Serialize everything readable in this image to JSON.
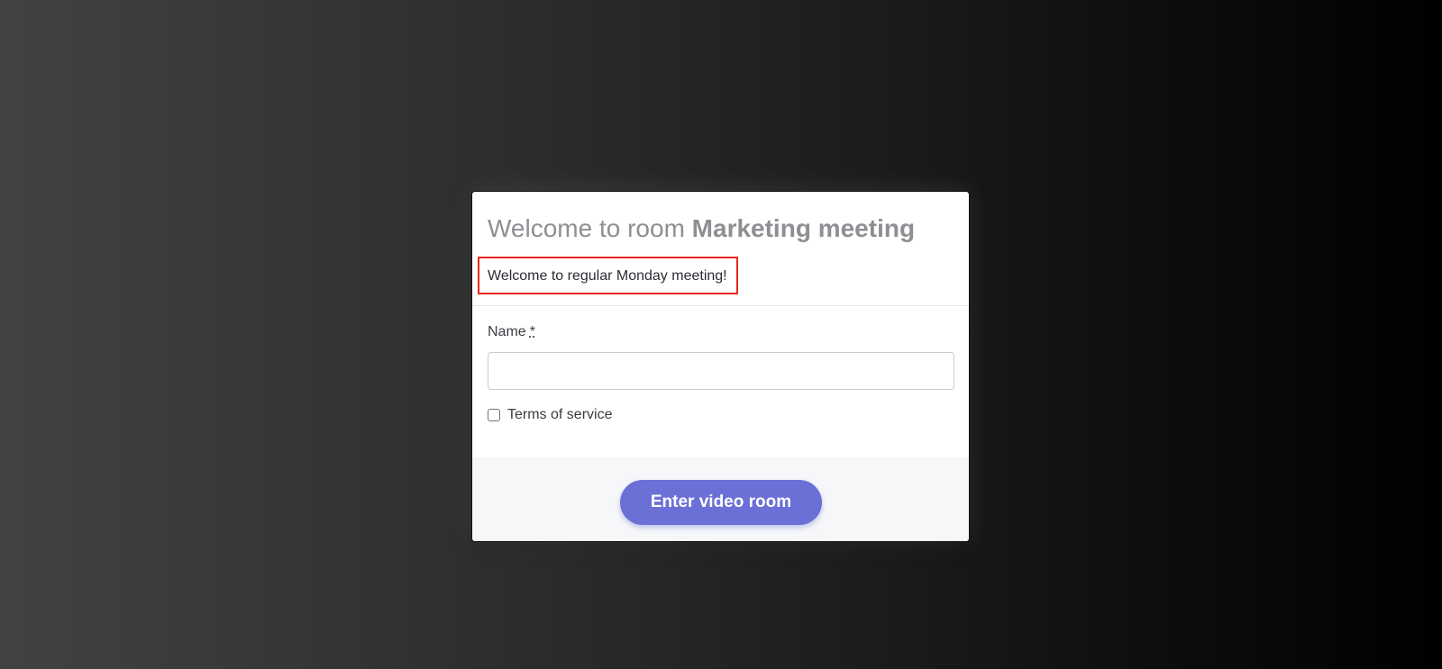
{
  "room": {
    "title_prefix": "Welcome to room",
    "name": "Marketing meeting",
    "welcome_message": "Welcome to regular Monday meeting!"
  },
  "form": {
    "name_label": "Name",
    "required_marker": "*",
    "name_value": "",
    "terms_label": "Terms of service",
    "terms_checked": false
  },
  "actions": {
    "enter_label": "Enter video room"
  },
  "colors": {
    "accent": "#6a70d6",
    "highlight_border": "#e8281f",
    "title_gray": "#8d8f93"
  }
}
